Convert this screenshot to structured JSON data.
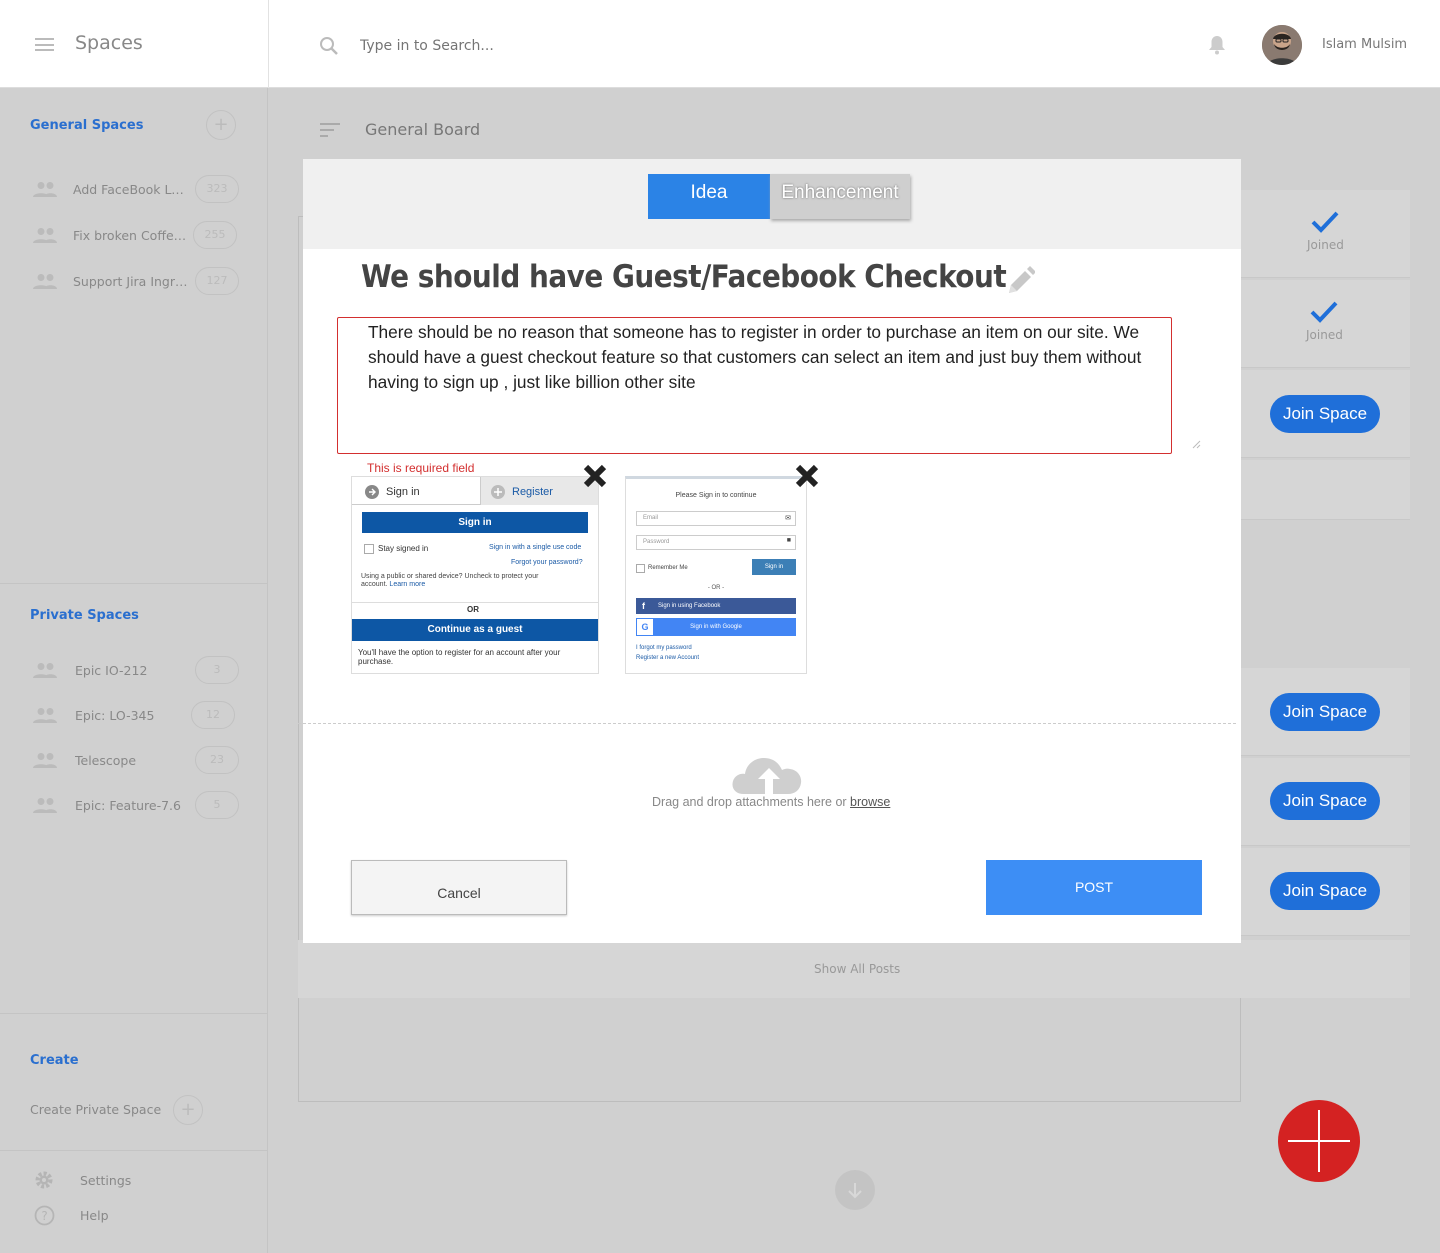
{
  "app": {
    "brand": "Spaces"
  },
  "search": {
    "placeholder": "Type in to Search..."
  },
  "user": {
    "name": "Islam Mulsim"
  },
  "sidebar": {
    "general_title": "General Spaces",
    "general_items": [
      {
        "label": "Add FaceBook Login",
        "count": "323"
      },
      {
        "label": "Fix broken Coffee o...",
        "count": "255"
      },
      {
        "label": "Support Jira Ingrat...",
        "count": "127"
      }
    ],
    "private_title": "Private Spaces",
    "private_items": [
      {
        "label": "Epic IO-212",
        "count": "3"
      },
      {
        "label": "Epic: LO-345",
        "count": "12"
      },
      {
        "label": "Telescope",
        "count": "23"
      },
      {
        "label": "Epic: Feature-7.6",
        "count": "5"
      }
    ],
    "create_title": "Create",
    "create_private": "Create Private Space",
    "settings": "Settings",
    "help": "Help"
  },
  "board": {
    "title": "General Board",
    "joined_label": "Joined",
    "join_label": "Join Space",
    "show_all": "Show All Posts"
  },
  "modal": {
    "tabs": [
      {
        "label": "Idea",
        "active": true
      },
      {
        "label": "Enhancement",
        "active": false
      }
    ],
    "title": "We should have Guest/Facebook Checkout",
    "description": "There should be no reason that someone has to register in order to purchase an item on our site. We should have a guest checkout feature so that customers can select an item and just buy them without having to sign up , just like billion other site",
    "error": "This is required field",
    "drop_text": "Drag and drop attachments here or",
    "browse": "browse",
    "cancel": "Cancel",
    "post": "POST"
  },
  "thumb1": {
    "tab_signin": "Sign in",
    "tab_register": "Register",
    "signin_btn": "Sign in",
    "stay": "Stay signed in",
    "single_code": "Sign in with a single use code",
    "forgot": "Forgot your password?",
    "public_note": "Using a public or shared device? Uncheck to protect your account.",
    "learn": "Learn more",
    "or": "OR",
    "guest_btn": "Continue as a guest",
    "guest_note": "You'll have the option to register for an account after your purchase."
  },
  "thumb2": {
    "heading": "Please Sign in to continue",
    "email": "Email",
    "password": "Password",
    "remember": "Remember Me",
    "signin": "Sign in",
    "or": "- OR -",
    "facebook": "Sign in using Facebook",
    "google": "Sign in with Google",
    "forgot": "I forgot my password",
    "register": "Register a new Account"
  },
  "colors": {
    "accent": "#2b83e6",
    "post": "#3d8ef5",
    "join": "#1f6fd9",
    "error": "#d32f2f",
    "fab": "#d42222"
  }
}
